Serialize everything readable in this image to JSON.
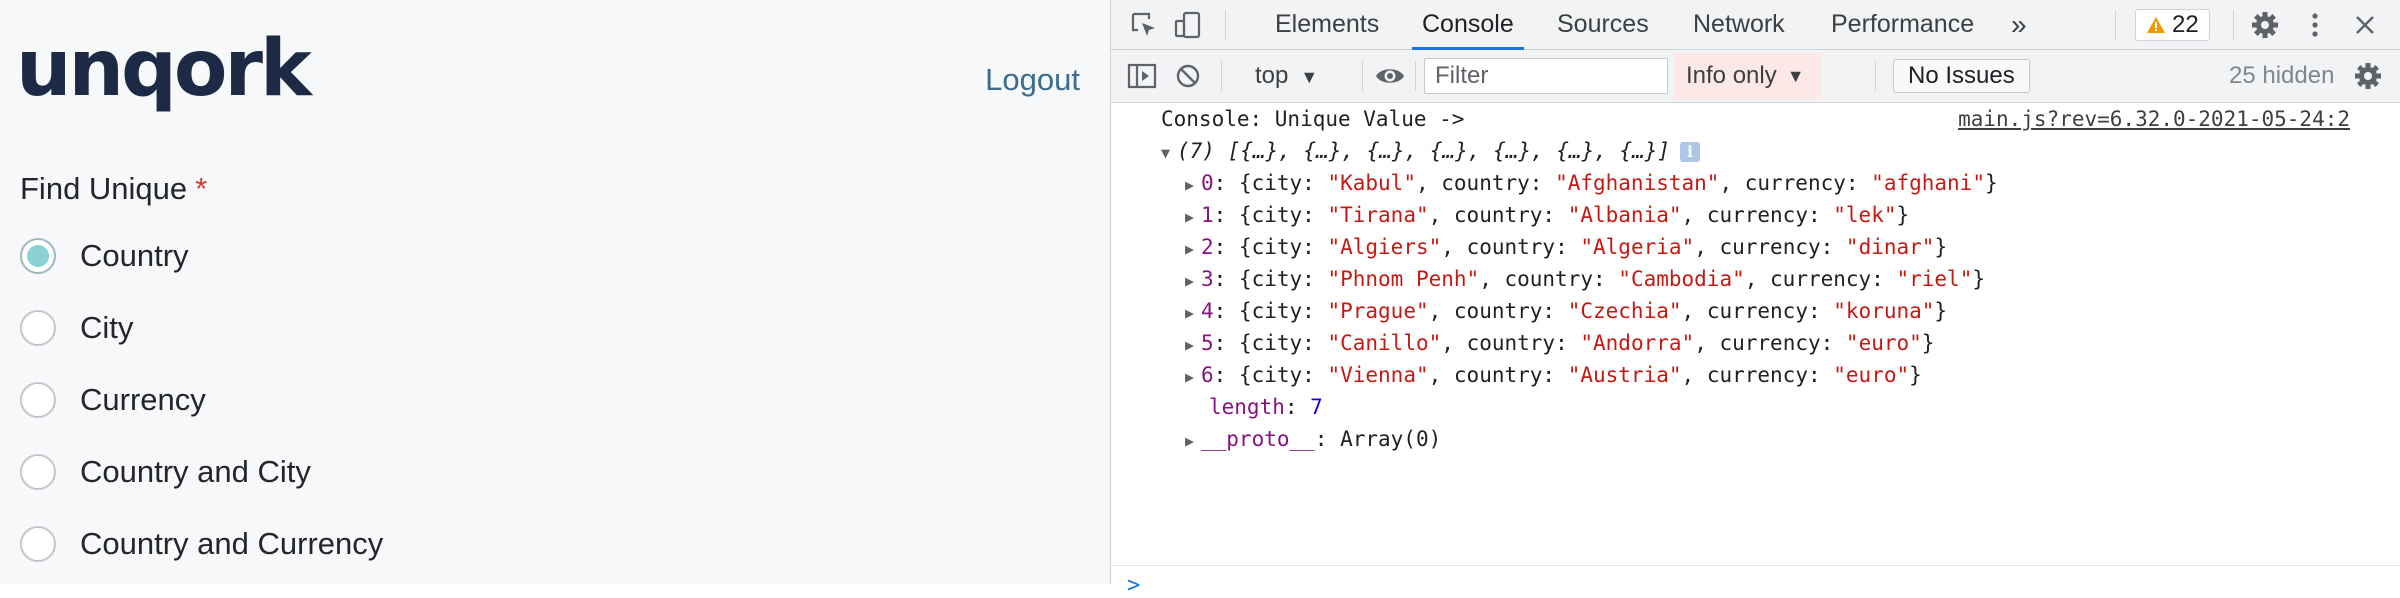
{
  "app": {
    "logo": "unqork",
    "logout_label": "Logout",
    "field_label": "Find Unique",
    "required_marker": "*",
    "options": [
      {
        "label": "Country",
        "checked": true
      },
      {
        "label": "City",
        "checked": false
      },
      {
        "label": "Currency",
        "checked": false
      },
      {
        "label": "Country and City",
        "checked": false
      },
      {
        "label": "Country and Currency",
        "checked": false
      }
    ]
  },
  "devtools": {
    "tabs": [
      "Elements",
      "Console",
      "Sources",
      "Network",
      "Performance"
    ],
    "active_tab": "Console",
    "more_tabs_glyph": "»",
    "warning_count": "22",
    "context": "top",
    "filter_placeholder": "Filter",
    "levels": "Info only",
    "issues": "No Issues",
    "hidden": "25 hidden",
    "accent_color": "#1a73e8"
  },
  "console": {
    "message": "Console: Unique Value ->",
    "source": "main.js?rev=6.32.0-2021-05-24:2",
    "array_summary": "(7) [{…}, {…}, {…}, {…}, {…}, {…}, {…}]",
    "rows": [
      {
        "index": "0",
        "city": "Kabul",
        "country": "Afghanistan",
        "currency": "afghani"
      },
      {
        "index": "1",
        "city": "Tirana",
        "country": "Albania",
        "currency": "lek"
      },
      {
        "index": "2",
        "city": "Algiers",
        "country": "Algeria",
        "currency": "dinar"
      },
      {
        "index": "3",
        "city": "Phnom Penh",
        "country": "Cambodia",
        "currency": "riel"
      },
      {
        "index": "4",
        "city": "Prague",
        "country": "Czechia",
        "currency": "koruna"
      },
      {
        "index": "5",
        "city": "Canillo",
        "country": "Andorra",
        "currency": "euro"
      },
      {
        "index": "6",
        "city": "Vienna",
        "country": "Austria",
        "currency": "euro"
      }
    ],
    "length_key": "length",
    "length_value": "7",
    "proto_key": "__proto__",
    "proto_value": "Array(0)",
    "prompt_glyph": ">"
  }
}
